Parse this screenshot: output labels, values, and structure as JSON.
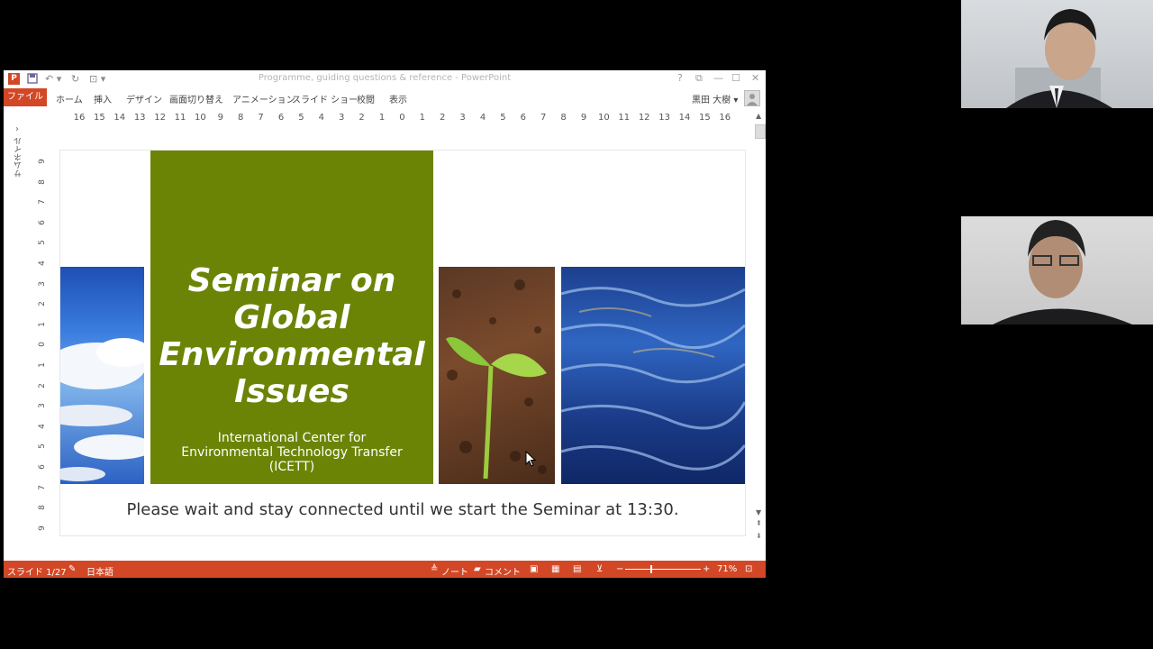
{
  "window": {
    "title": "Programme, guiding questions & reference - PowerPoint",
    "user": "黒田 大樹 ▾",
    "help_icon": "?",
    "buttons": [
      "?",
      "⧉",
      "—",
      "☐",
      "✕"
    ]
  },
  "ribbon": {
    "file_tab": "ファイル",
    "tabs": [
      "ホーム",
      "挿入",
      "デザイン",
      "画面切り替え",
      "アニメーション",
      "スライド ショー",
      "校閲",
      "表示"
    ]
  },
  "thumbnail_panel": {
    "label": "サムネイル",
    "chevron": "›"
  },
  "ruler": {
    "horizontal": [
      "16",
      "15",
      "14",
      "13",
      "12",
      "11",
      "10",
      "9",
      "8",
      "7",
      "6",
      "5",
      "4",
      "3",
      "2",
      "1",
      "0",
      "1",
      "2",
      "3",
      "4",
      "5",
      "6",
      "7",
      "8",
      "9",
      "10",
      "11",
      "12",
      "13",
      "14",
      "15",
      "16"
    ],
    "vertical": [
      "9",
      "8",
      "7",
      "6",
      "5",
      "4",
      "3",
      "2",
      "1",
      "0",
      "1",
      "2",
      "3",
      "4",
      "5",
      "6",
      "7",
      "8",
      "9"
    ]
  },
  "slide": {
    "title_lines": [
      "Seminar on",
      "Global",
      "Environmental",
      "Issues"
    ],
    "subtitle_lines": [
      "International Center for",
      "Environmental Technology Transfer",
      "(ICETT)"
    ],
    "footer": "Please wait and stay connected until we start the Seminar at 13:30.",
    "colors": {
      "green": "#6b8406",
      "status": "#d24726"
    }
  },
  "statusbar": {
    "slide": "スライド 1/27",
    "language": "日本語",
    "notes": "ノート",
    "comments": "コメント",
    "zoom": "71%",
    "zoom_minus": "−",
    "zoom_plus": "+"
  }
}
